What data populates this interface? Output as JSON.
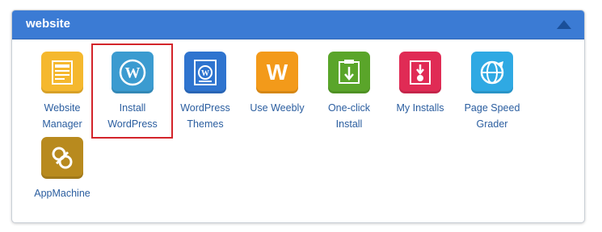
{
  "panel": {
    "title": "website",
    "toggle_icon": "caret-up-icon"
  },
  "tiles": [
    {
      "id": "website-manager",
      "icon": "website-manager-icon",
      "color": "#f5b82e",
      "label_lines": [
        "Website",
        "Manager"
      ]
    },
    {
      "id": "install-wordpress",
      "icon": "wordpress-icon",
      "color": "#3b9bd0",
      "label_lines": [
        "Install",
        "WordPress"
      ],
      "highlighted": true
    },
    {
      "id": "wordpress-themes",
      "icon": "wordpress-themes-icon",
      "color": "#2f74cf",
      "label_lines": [
        "WordPress",
        "Themes"
      ]
    },
    {
      "id": "use-weebly",
      "icon": "weebly-icon",
      "color": "#f39a1a",
      "label_lines": [
        "Use Weebly"
      ],
      "glyph": "W"
    },
    {
      "id": "one-click-install",
      "icon": "one-click-install-icon",
      "color": "#5aa52a",
      "label_lines": [
        "One-click",
        "Install"
      ]
    },
    {
      "id": "my-installs",
      "icon": "my-installs-icon",
      "color": "#e02b55",
      "label_lines": [
        "My Installs"
      ]
    },
    {
      "id": "page-speed-grader",
      "icon": "globe-icon",
      "color": "#2fa9e3",
      "label_lines": [
        "Page Speed",
        "Grader"
      ]
    },
    {
      "id": "appmachine",
      "icon": "appmachine-icon",
      "color": "#b88a1e",
      "label_lines": [
        "AppMachine"
      ]
    }
  ]
}
